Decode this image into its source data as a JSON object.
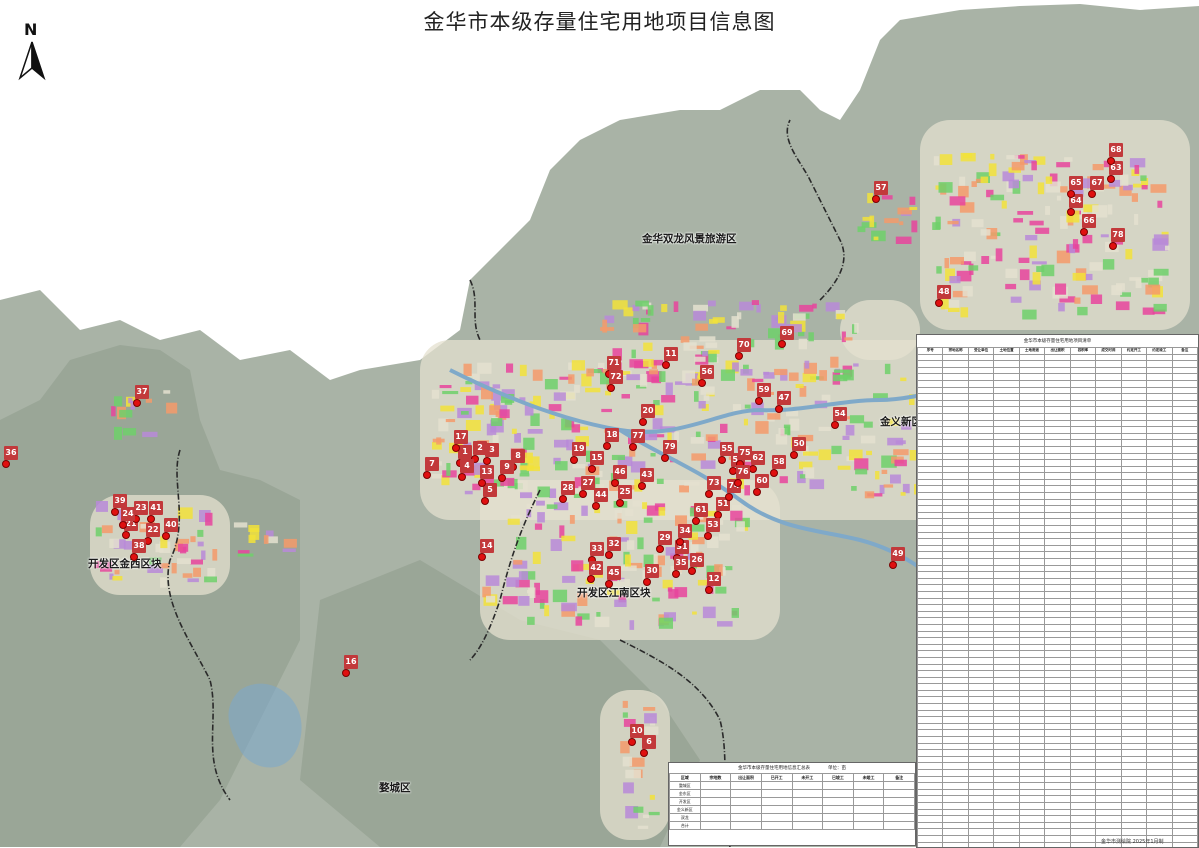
{
  "title": "金华市本级存量住宅用地项目信息图",
  "north_arrow": {
    "letter": "N",
    "icon": "north-arrow-icon"
  },
  "colors": {
    "terrain": "#a9b3a6",
    "terrain_dark": "#8e9b8a",
    "urban": "#e4e0cf",
    "water": "#7fa9c9",
    "marker": "#c2393b",
    "pin": "#e01010",
    "boundary": "#2a2a2a",
    "residential": "#f2e23a",
    "commercial": "#e8449c",
    "industrial": "#b98ad8",
    "green": "#6fd06a",
    "education": "#f59a6a"
  },
  "regions": [
    {
      "id": "shuanglong",
      "label": "金华双龙风景旅游区"
    },
    {
      "id": "jinyi",
      "label": "金义新区"
    },
    {
      "id": "kaifa_jinxi",
      "label": "开发区金西区块"
    },
    {
      "id": "kaifa_jiangnan",
      "label": "开发区江南区块"
    },
    {
      "id": "wucheng",
      "label": "婺城区"
    }
  ],
  "markers": [
    "1",
    "2",
    "3",
    "4",
    "5",
    "6",
    "7",
    "8",
    "9",
    "10",
    "11",
    "12",
    "13",
    "14",
    "15",
    "16",
    "17",
    "18",
    "19",
    "20",
    "21",
    "22",
    "23",
    "24",
    "25",
    "26",
    "27",
    "28",
    "29",
    "30",
    "31",
    "32",
    "33",
    "34",
    "35",
    "36",
    "37",
    "38",
    "39",
    "40",
    "41",
    "42",
    "43",
    "44",
    "45",
    "46",
    "47",
    "48",
    "49",
    "50",
    "51",
    "52",
    "53",
    "54",
    "55",
    "56",
    "57",
    "58",
    "59",
    "60",
    "61",
    "62",
    "63",
    "64",
    "65",
    "66",
    "67",
    "68",
    "69",
    "70",
    "71",
    "72",
    "73",
    "74",
    "75",
    "76",
    "77",
    "78",
    "79"
  ],
  "table": {
    "title": "金华市本级存量住宅用地项目清单",
    "headers": [
      "序号",
      "宗地名称",
      "受让单位",
      "土地位置",
      "土地用途",
      "出让面积",
      "容积率",
      "成交时间",
      "约定开工",
      "约定竣工",
      "备注"
    ]
  },
  "summary": {
    "title": "金华市本级存量住宅用地信息汇总表",
    "unit": "单位：亩",
    "headers": [
      "区域",
      "宗地数",
      "出让面积",
      "已开工",
      "未开工",
      "已竣工",
      "未竣工",
      "备注"
    ],
    "rows": [
      [
        "婺城区",
        "",
        "",
        "",
        "",
        "",
        "",
        ""
      ],
      [
        "金东区",
        "",
        "",
        "",
        "",
        "",
        "",
        ""
      ],
      [
        "开发区",
        "",
        "",
        "",
        "",
        "",
        "",
        ""
      ],
      [
        "金义新区",
        "",
        "",
        "",
        "",
        "",
        "",
        ""
      ],
      [
        "双龙",
        "",
        "",
        "",
        "",
        "",
        "",
        ""
      ],
      [
        "合计",
        "",
        "",
        "",
        "",
        "",
        "",
        ""
      ]
    ]
  },
  "footer": "金华市测绘院  2025年1月制"
}
